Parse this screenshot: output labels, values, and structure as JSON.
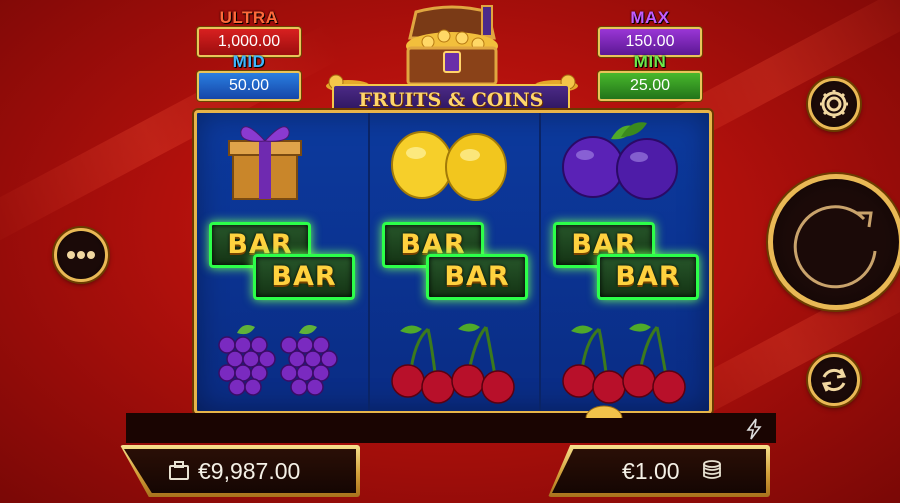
{
  "game": {
    "title": "FRUITS & COINS"
  },
  "jackpots": {
    "ultra": {
      "label": "ULTRA",
      "value": "1,000.00"
    },
    "mid": {
      "label": "MID",
      "value": "50.00"
    },
    "max": {
      "label": "MAX",
      "value": "150.00"
    },
    "min": {
      "label": "MIN",
      "value": "25.00"
    }
  },
  "reels": [
    {
      "symbols": [
        "gift-box",
        "bar-double",
        "grapes"
      ]
    },
    {
      "symbols": [
        "lemons",
        "bar-double",
        "cherries"
      ]
    },
    {
      "symbols": [
        "plums",
        "bar-double",
        "cherries"
      ]
    }
  ],
  "symbol_text": {
    "bar": "BAR"
  },
  "footer": {
    "balance": "€9,987.00",
    "bet": "€1.00"
  },
  "buttons": {
    "settings_icon": "gear-icon",
    "menu_icon": "ellipsis-icon",
    "spin_icon": "spin-arrow-icon",
    "autoplay_icon": "refresh-icon",
    "turbo_icon": "lightning-icon"
  },
  "colors": {
    "gold": "#e9b955",
    "reel_bg": "#0c3a9e",
    "background": "#b0100c"
  }
}
